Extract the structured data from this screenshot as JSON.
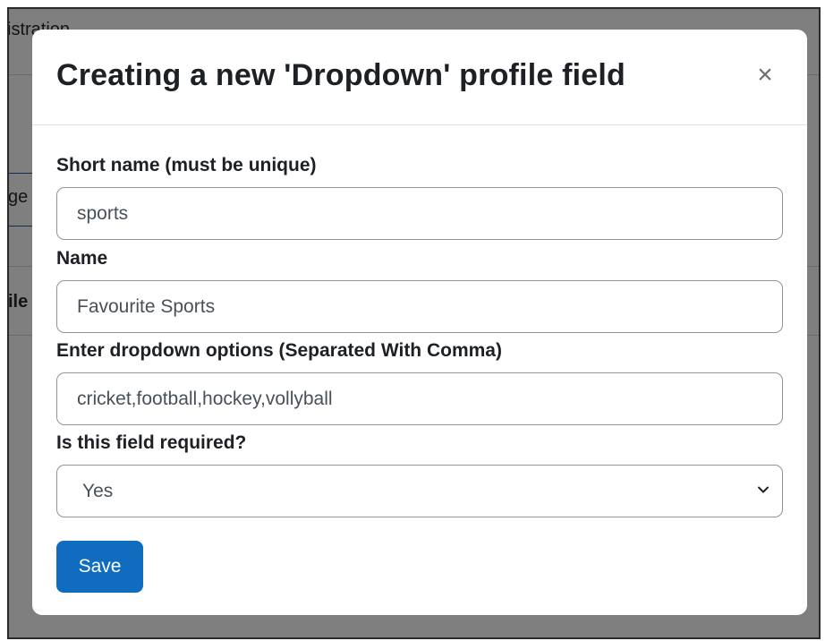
{
  "background": {
    "fragment_top": "istration",
    "fragment_tab": "ge",
    "fragment_row": "ile"
  },
  "modal": {
    "title": "Creating a new 'Dropdown' profile field",
    "close_label": "×",
    "fields": {
      "short_name": {
        "label": "Short name (must be unique)",
        "value": "sports"
      },
      "name": {
        "label": "Name",
        "value": "Favourite Sports"
      },
      "options": {
        "label": "Enter dropdown options (Separated With Comma)",
        "value": "cricket,football,hockey,vollyball"
      },
      "required": {
        "label": "Is this field required?",
        "selected": "Yes"
      }
    },
    "save_label": "Save"
  },
  "colors": {
    "primary": "#0f6cbf",
    "backdrop": "rgba(0,0,0,0.5)",
    "input_border": "#8f959e"
  }
}
